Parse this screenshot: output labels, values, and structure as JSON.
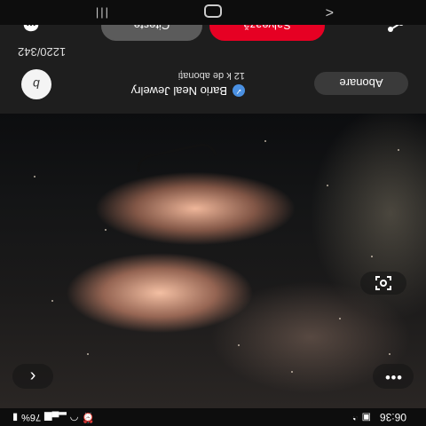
{
  "status_bar": {
    "time": "06:36",
    "left_icons": [
      "gallery-icon",
      "whatsapp-icon"
    ],
    "battery": "76%",
    "right_icons": [
      "wifi-icon",
      "signal-icon",
      "battery-icon",
      "alarm-icon"
    ]
  },
  "pin": {
    "author_name": "Bario Neal Jewelry",
    "follower_count": "12 k de abonați",
    "follow_label": "Abonare",
    "avatar_letter": "b",
    "pin_code": "1220/342",
    "visit_label": "Citește",
    "save_label": "Salvează"
  },
  "nav_bar": {
    "back_glyph": "<",
    "recents_glyph": "|||"
  },
  "colors": {
    "save_button": "#e60023",
    "visit_button": "#5b5b5b",
    "panel_background": "#1e1e1e",
    "verified_badge": "#4a90e2"
  },
  "icons": {
    "share": "share-icon",
    "comment": "comment-icon",
    "more": "more-icon",
    "back": "back-icon",
    "visual_search": "visual-search-icon",
    "verified": "verified-icon"
  }
}
